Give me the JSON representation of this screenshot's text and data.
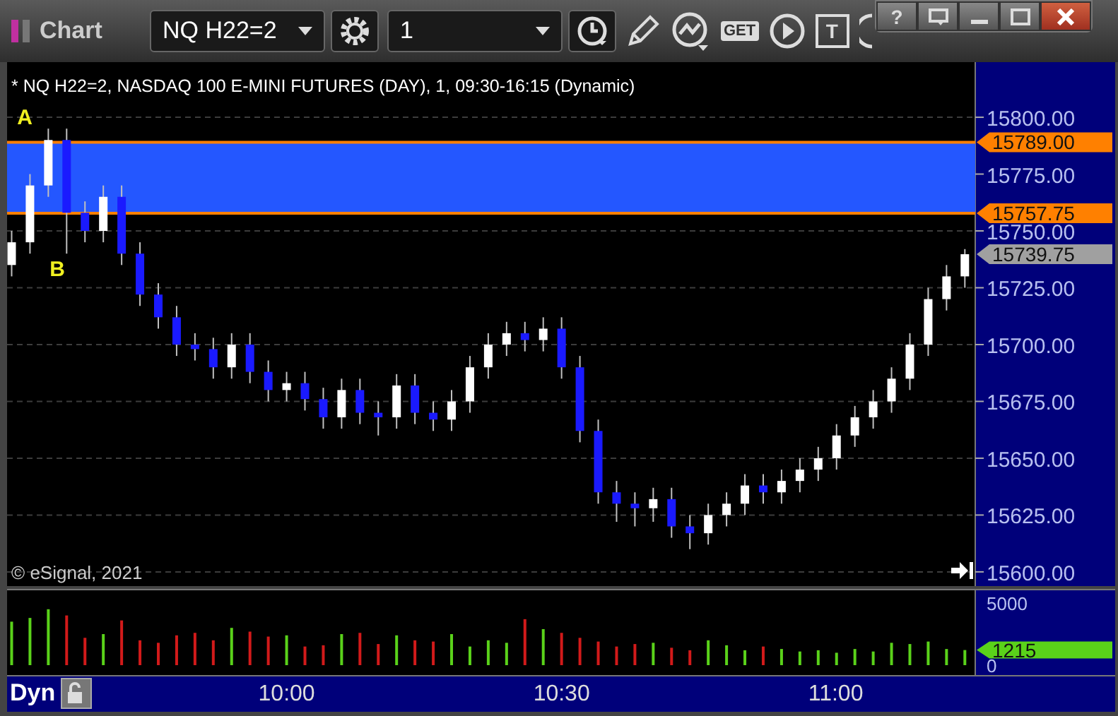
{
  "window": {
    "title": "Chart",
    "controls": [
      {
        "kind": "help",
        "label": "?"
      },
      {
        "kind": "restore"
      },
      {
        "kind": "minimize"
      },
      {
        "kind": "maximize"
      },
      {
        "kind": "close"
      }
    ]
  },
  "toolbar": {
    "symbol": "NQ H22=2",
    "interval": "1",
    "tools": [
      {
        "kind": "pencil"
      },
      {
        "kind": "study"
      },
      {
        "kind": "get",
        "label": "GET"
      },
      {
        "kind": "play"
      },
      {
        "kind": "text",
        "label": "T"
      },
      {
        "kind": "annotation"
      }
    ]
  },
  "chart": {
    "info": "* NQ H22=2, NASDAQ 100 E-MINI FUTURES (DAY), 1, 09:30-16:15 (Dynamic)",
    "copyright": "© eSignal, 2021",
    "last_price": "15739.75",
    "chart_data": {
      "type": "candlestick",
      "grid": true,
      "categories": [
        null,
        null,
        null,
        null,
        null,
        null,
        null,
        null,
        null,
        null,
        null,
        null,
        null,
        null,
        null,
        null,
        null,
        null,
        null,
        null,
        null,
        null,
        null,
        null,
        null,
        null,
        null,
        null,
        null,
        null,
        null,
        null,
        null,
        null,
        null,
        null,
        null,
        null,
        null,
        null,
        null,
        null,
        null,
        null,
        null,
        null,
        null,
        null,
        null,
        null,
        null,
        null,
        null
      ],
      "ohlc": [
        [
          15735,
          15750,
          15730,
          15745
        ],
        [
          15745,
          15775,
          15740,
          15770
        ],
        [
          15770,
          15795,
          15765,
          15790
        ],
        [
          15790,
          15795,
          15740,
          15758
        ],
        [
          15758,
          15763,
          15745,
          15750
        ],
        [
          15750,
          15770,
          15745,
          15765
        ],
        [
          15765,
          15770,
          15735,
          15740
        ],
        [
          15740,
          15745,
          15717,
          15722
        ],
        [
          15722,
          15727,
          15707,
          15712
        ],
        [
          15712,
          15717,
          15695,
          15700
        ],
        [
          15700,
          15705,
          15693,
          15698
        ],
        [
          15698,
          15703,
          15685,
          15690
        ],
        [
          15690,
          15705,
          15685,
          15700
        ],
        [
          15700,
          15705,
          15683,
          15688
        ],
        [
          15688,
          15693,
          15675,
          15680
        ],
        [
          15680,
          15688,
          15675,
          15683
        ],
        [
          15683,
          15688,
          15671,
          15676
        ],
        [
          15676,
          15681,
          15663,
          15668
        ],
        [
          15668,
          15685,
          15663,
          15680
        ],
        [
          15680,
          15685,
          15665,
          15670
        ],
        [
          15670,
          15675,
          15660,
          15668
        ],
        [
          15668,
          15687,
          15663,
          15682
        ],
        [
          15682,
          15687,
          15665,
          15670
        ],
        [
          15670,
          15675,
          15662,
          15667
        ],
        [
          15667,
          15680,
          15662,
          15675
        ],
        [
          15675,
          15695,
          15670,
          15690
        ],
        [
          15690,
          15705,
          15685,
          15700
        ],
        [
          15700,
          15710,
          15695,
          15705
        ],
        [
          15705,
          15710,
          15697,
          15702
        ],
        [
          15702,
          15712,
          15697,
          15707
        ],
        [
          15707,
          15712,
          15685,
          15690
        ],
        [
          15690,
          15695,
          15657,
          15662
        ],
        [
          15662,
          15667,
          15630,
          15635
        ],
        [
          15635,
          15640,
          15622,
          15630
        ],
        [
          15630,
          15635,
          15620,
          15628
        ],
        [
          15628,
          15637,
          15622,
          15632
        ],
        [
          15632,
          15637,
          15615,
          15620
        ],
        [
          15620,
          15625,
          15610,
          15617
        ],
        [
          15617,
          15630,
          15612,
          15625
        ],
        [
          15625,
          15635,
          15620,
          15630
        ],
        [
          15630,
          15643,
          15625,
          15638
        ],
        [
          15638,
          15643,
          15630,
          15635
        ],
        [
          15635,
          15645,
          15630,
          15640
        ],
        [
          15640,
          15650,
          15635,
          15645
        ],
        [
          15645,
          15655,
          15640,
          15650
        ],
        [
          15650,
          15665,
          15645,
          15660
        ],
        [
          15660,
          15673,
          15655,
          15668
        ],
        [
          15668,
          15680,
          15663,
          15675
        ],
        [
          15675,
          15690,
          15670,
          15685
        ],
        [
          15685,
          15705,
          15680,
          15700
        ],
        [
          15700,
          15725,
          15695,
          15720
        ],
        [
          15720,
          15735,
          15715,
          15730
        ],
        [
          15730,
          15742,
          15725,
          15739.75
        ]
      ],
      "ylim": [
        15593.75,
        15824.25
      ],
      "yticks": [
        {
          "value": 15600,
          "label": "15600.00"
        },
        {
          "value": 15625,
          "label": "15625.00"
        },
        {
          "value": 15650,
          "label": "15650.00"
        },
        {
          "value": 15675,
          "label": "15675.00"
        },
        {
          "value": 15700,
          "label": "15700.00"
        },
        {
          "value": 15725,
          "label": "15725.00"
        },
        {
          "value": 15750,
          "label": "15750.00"
        },
        {
          "value": 15775,
          "label": "15775.00"
        },
        {
          "value": 15800,
          "label": "15800.00"
        }
      ],
      "bands": [
        {
          "axis": "y",
          "from": 15757.75,
          "to": 15789,
          "color": "#2457ff"
        }
      ],
      "ref_lines": [
        {
          "axis": "y",
          "value": 15789,
          "label": "15789.00",
          "color": "#ff8000"
        },
        {
          "axis": "y",
          "value": 15757.75,
          "label": "15757.75",
          "color": "#ff8000"
        }
      ],
      "annotations": [
        "A",
        "B"
      ]
    }
  },
  "volume": {
    "chart_data": {
      "type": "bar",
      "stacked": true,
      "x": [
        570,
        572,
        574,
        576,
        578,
        580,
        582,
        584,
        586,
        588,
        590,
        592,
        594,
        596,
        598,
        600,
        602,
        604,
        606,
        608,
        610,
        612,
        614,
        616,
        618,
        620,
        622,
        624,
        626,
        628,
        630,
        632,
        634,
        636,
        638,
        640,
        642,
        644,
        646,
        648,
        650,
        652,
        654,
        656,
        658,
        660,
        662,
        664,
        666,
        668,
        670,
        672,
        674
      ],
      "xlim": [
        569.5,
        690.4
      ],
      "xticks": [
        {
          "value": 600,
          "label": "10:00"
        },
        {
          "value": 630,
          "label": "10:30"
        },
        {
          "value": 660,
          "label": "11:00"
        }
      ],
      "series": [
        {
          "color": "#5ad21a",
          "values": [
            3500,
            3800,
            4500,
            null,
            null,
            2500,
            null,
            null,
            null,
            null,
            null,
            null,
            3000,
            null,
            null,
            2400,
            null,
            null,
            2500,
            null,
            null,
            2400,
            null,
            null,
            2500,
            1500,
            2000,
            1800,
            null,
            2900,
            null,
            null,
            null,
            null,
            null,
            1800,
            null,
            null,
            2000,
            1600,
            1200,
            null,
            1300,
            1100,
            1200,
            1000,
            1300,
            1100,
            1800,
            1700,
            1900,
            1300,
            1215
          ]
        },
        {
          "color": "#d21a1a",
          "values": [
            null,
            null,
            null,
            4000,
            2200,
            null,
            3600,
            2000,
            1800,
            2400,
            2600,
            2000,
            null,
            2700,
            2300,
            null,
            1500,
            1600,
            null,
            2600,
            1700,
            null,
            2000,
            1900,
            null,
            null,
            null,
            null,
            3700,
            null,
            2600,
            2200,
            1900,
            1500,
            1700,
            null,
            1400,
            1200,
            null,
            null,
            null,
            1500,
            null,
            null,
            null,
            null,
            null,
            null,
            null,
            null,
            null,
            null,
            null
          ]
        }
      ],
      "ylim": [
        0,
        5000
      ],
      "yticks": [
        {
          "value": 0,
          "label": "0"
        },
        {
          "value": 5000,
          "label": "5000"
        }
      ]
    },
    "last_volume": "1215"
  },
  "time_axis": {
    "mode": "Dyn",
    "locked": false
  }
}
